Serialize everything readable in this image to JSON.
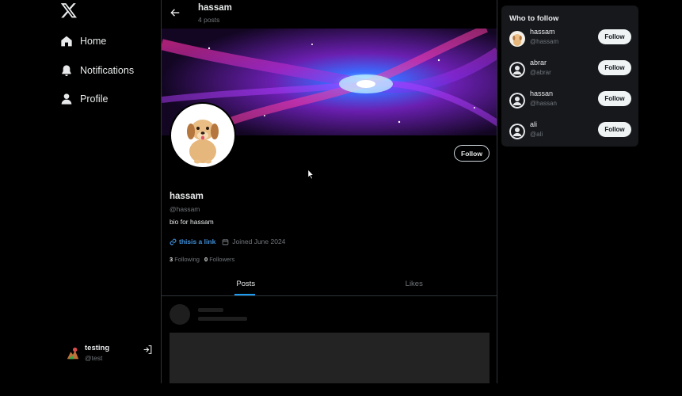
{
  "nav": {
    "logo_icon": "x-logo-icon",
    "items": [
      {
        "label": "Home",
        "icon": "home-icon"
      },
      {
        "label": "Notifications",
        "icon": "bell-icon"
      },
      {
        "label": "Profile",
        "icon": "user-icon"
      }
    ]
  },
  "current_user": {
    "name": "testing",
    "handle": "@test"
  },
  "header": {
    "name": "hassam",
    "posts": "4 posts"
  },
  "profile": {
    "name": "hassam",
    "handle": "@hassam",
    "bio": "bio for hassam",
    "link_text": "thisis a link",
    "joined": "Joined June 2024",
    "following_count": "3",
    "following_label": "Following",
    "followers_count": "0",
    "followers_label": "Followers",
    "follow_label": "Follow"
  },
  "tabs": [
    {
      "label": "Posts",
      "active": true
    },
    {
      "label": "Likes",
      "active": false
    }
  ],
  "who_to_follow": {
    "title": "Who to follow",
    "users": [
      {
        "name": "hassam",
        "handle": "@hassam",
        "button": "Follow"
      },
      {
        "name": "abrar",
        "handle": "@abrar",
        "button": "Follow"
      },
      {
        "name": "hassan",
        "handle": "@hassan",
        "button": "Follow"
      },
      {
        "name": "ali",
        "handle": "@ali",
        "button": "Follow"
      }
    ]
  },
  "colors": {
    "accent": "#1d9bf0",
    "link": "#3f8fd8",
    "muted": "#71767b",
    "panel": "#16181c"
  }
}
